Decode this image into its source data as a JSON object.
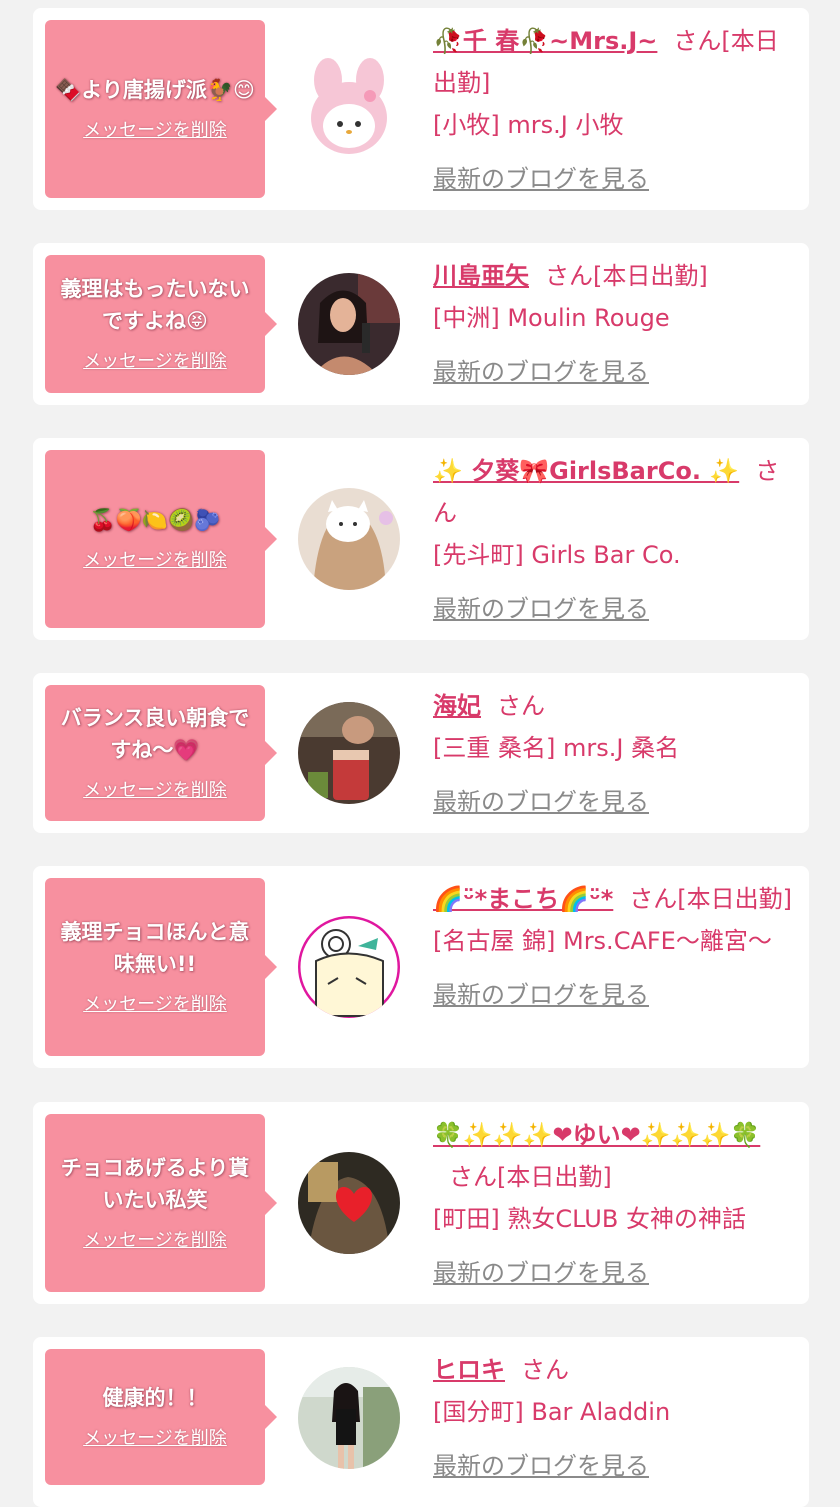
{
  "delete_label": "メッセージを削除",
  "san_label": "さん",
  "blog_label": "最新のブログを見る",
  "colors": {
    "bubble": "#f7909f",
    "accent": "#d83a6a",
    "link_gray": "#8a8a8a",
    "background": "#f2f2f2"
  },
  "messages": [
    {
      "message": "🍫より唐揚げ派🐓😊",
      "name": "🥀千 春🥀~Mrs.J~",
      "status": "[本日出勤]",
      "shop": "[小牧] mrs.J 小牧",
      "avatar_icon": "my-melody-plush-icon"
    },
    {
      "message": "義理はもったいないですよね😝",
      "name": "川島亜矢",
      "status": "[本日出勤]",
      "shop": "[中洲] Moulin Rouge",
      "avatar_icon": "woman-photo-icon"
    },
    {
      "message": "🍒🍑🍋🥝🫐",
      "name": "✨ 夕葵🎀GirlsBarCo. ✨",
      "status": "",
      "shop": "[先斗町] Girls Bar Co.",
      "avatar_icon": "cat-sticker-photo-icon"
    },
    {
      "message": "バランス良い朝食ですね〜💗",
      "name": "海妃",
      "status": "",
      "shop": "[三重 桑名] mrs.J 桑名",
      "avatar_icon": "drink-photo-icon"
    },
    {
      "message": "義理チョコほんと意味無い!!",
      "name": "🌈ᵕ̈*まこち🌈ᵕ̈*",
      "status": "[本日出勤]",
      "shop": "[名古屋 錦] Mrs.CAFE～離宮～",
      "avatar_icon": "drawing-girl-icon"
    },
    {
      "message": "チョコあげるより貰いたい私笑",
      "name": "🍀✨✨✨❤ゆい❤✨✨✨🍀",
      "status": "[本日出勤]",
      "shop": "[町田] 熟女CLUB 女神の神話",
      "avatar_icon": "heart-photo-icon"
    },
    {
      "message": "健康的！！",
      "name": "ヒロキ",
      "status": "",
      "shop": "[国分町] Bar Aladdin",
      "avatar_icon": "woman-standing-photo-icon"
    }
  ]
}
